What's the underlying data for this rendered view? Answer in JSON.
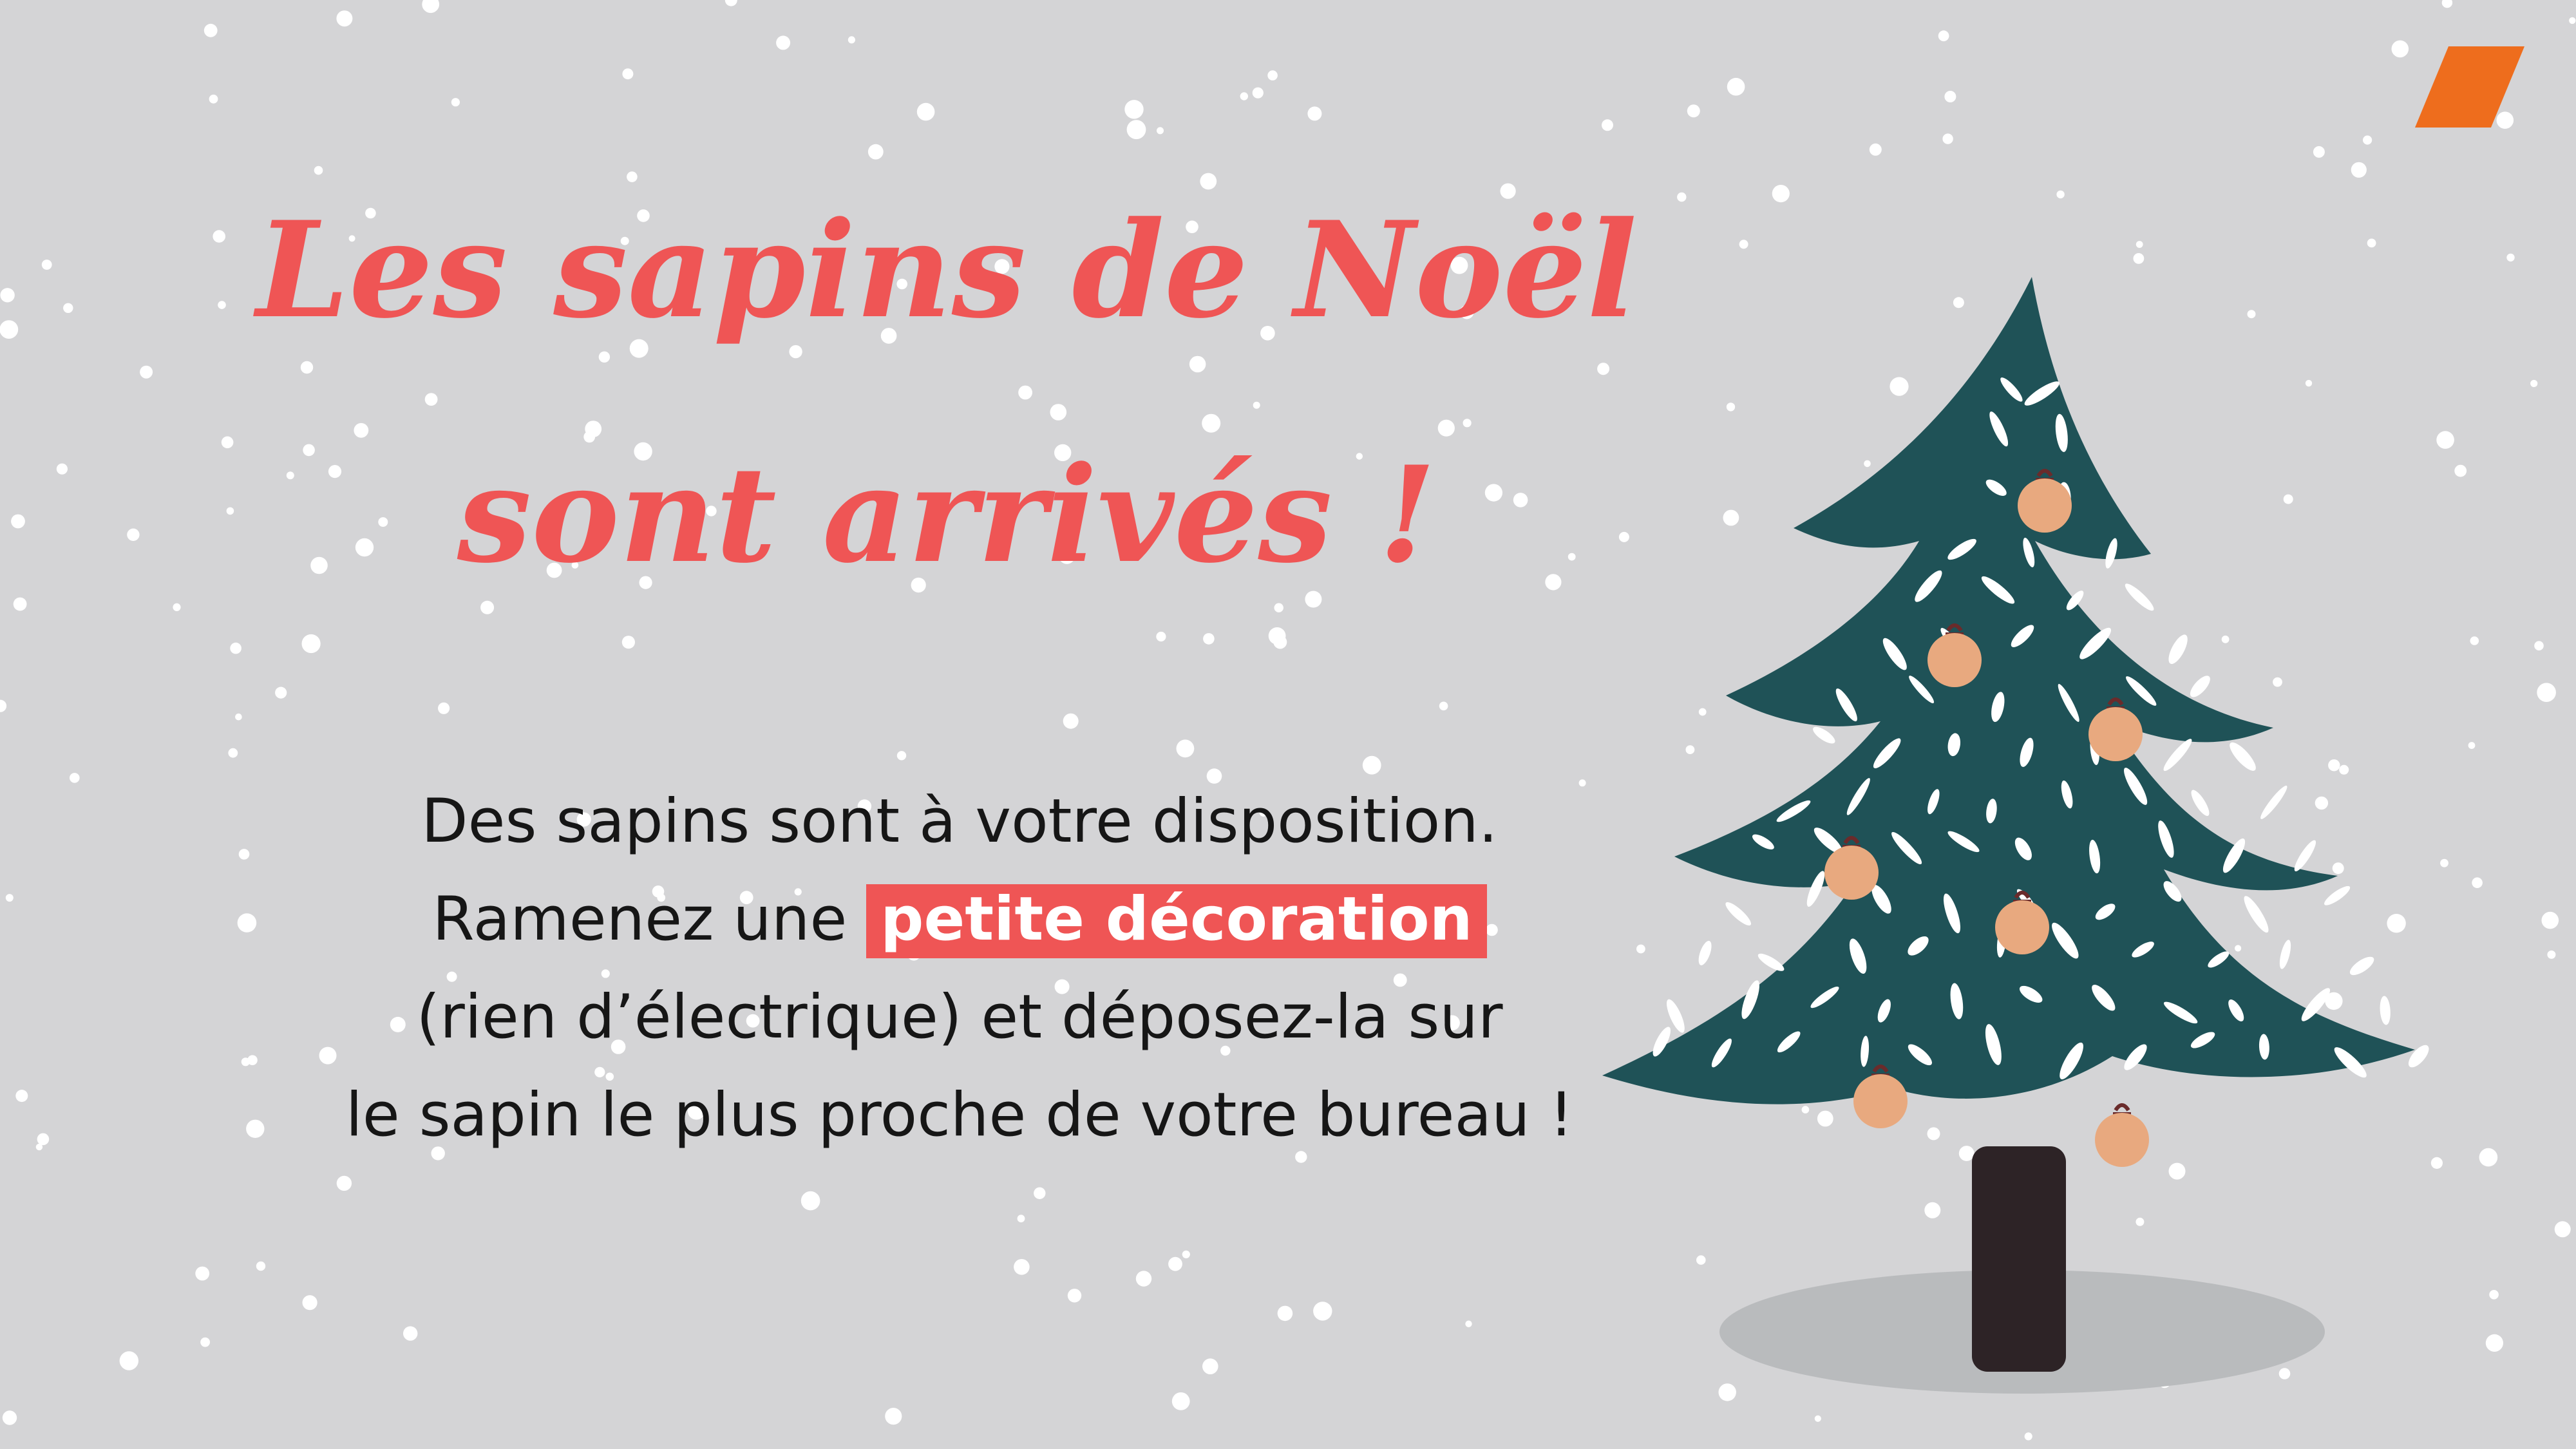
{
  "title": {
    "line1": "Les sapins de Noël",
    "line2": "sont arrivés !"
  },
  "body": {
    "line1": "Des sapins sont à votre disposition.",
    "line2_before": "Ramenez une ",
    "line2_highlight": "petite décoration",
    "line3": "(rien d’électrique) et déposez-la sur",
    "line4": "le sapin le plus proche de votre bureau !"
  },
  "colors": {
    "background": "#d4d4d6",
    "title": "#ef5555",
    "highlight": "#ef5555",
    "tree": "#1f5257",
    "trunk": "#2d2326",
    "ornament": "#e8a97f",
    "brand_mark": "#ee6d1d",
    "snow": "#ffffff"
  },
  "icons": {
    "brand_mark": "orange-parallelogram-logo",
    "tree": "christmas-tree-illustration"
  }
}
